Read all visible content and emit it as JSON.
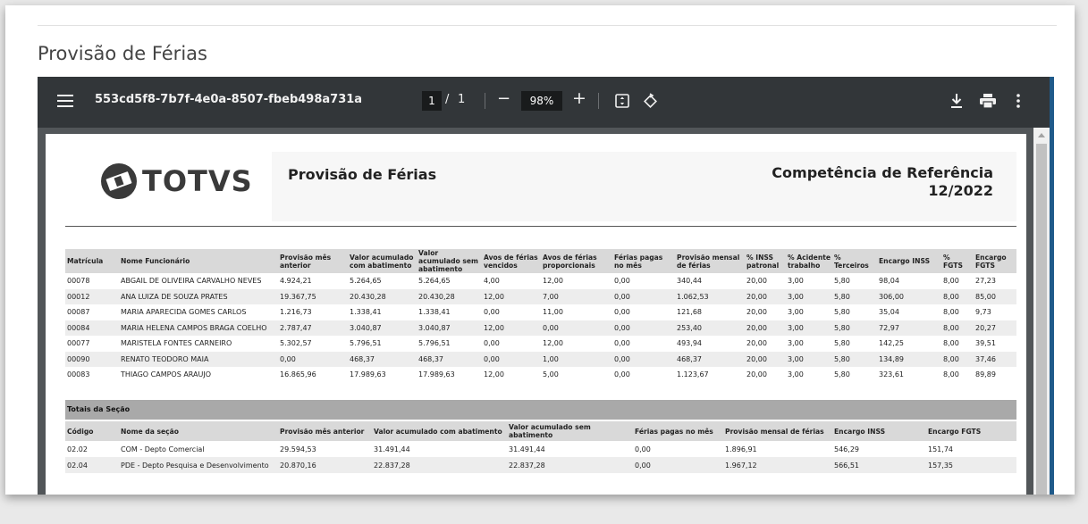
{
  "page": {
    "title": "Provisão de Férias"
  },
  "viewer": {
    "document_name": "553cd5f8-7b7f-4e0a-8507-fbeb498a731a",
    "current_page": "1",
    "page_separator": "/",
    "total_pages": "1",
    "zoom": "98%",
    "zoom_out": "−",
    "zoom_in": "+",
    "icons": [
      "menu-icon",
      "fit-page-icon",
      "rotate-icon",
      "download-icon",
      "print-icon",
      "more-options-icon"
    ]
  },
  "report": {
    "logo_text": "TOTVS",
    "title": "Provisão de Férias",
    "competence_label": "Competência de Referência",
    "competence_value": "12/2022",
    "employee_columns": [
      "Matrícula",
      "Nome Funcionário",
      "Provisão mês anterior",
      "Valor acumulado com abatimento",
      "Valor acumulado sem abatimento",
      "Avos de férias vencidos",
      "Avos de férias proporcionais",
      "Férias pagas no mês",
      "Provisão mensal de férias",
      "% INSS patronal",
      "% Acidente trabalho",
      "% Terceiros",
      "Encargo INSS",
      "% FGTS",
      "Encargo FGTS"
    ],
    "employees": [
      [
        "00078",
        "ABGAIL DE OLIVEIRA CARVALHO NEVES",
        "4.924,21",
        "5.264,65",
        "5.264,65",
        "4,00",
        "12,00",
        "0,00",
        "340,44",
        "20,00",
        "3,00",
        "5,80",
        "98,04",
        "8,00",
        "27,23"
      ],
      [
        "00012",
        "ANA LUIZA  DE SOUZA PRATES",
        "19.367,75",
        "20.430,28",
        "20.430,28",
        "12,00",
        "7,00",
        "0,00",
        "1.062,53",
        "20,00",
        "3,00",
        "5,80",
        "306,00",
        "8,00",
        "85,00"
      ],
      [
        "00087",
        "MARIA APARECIDA GOMES CARLOS",
        "1.216,73",
        "1.338,41",
        "1.338,41",
        "0,00",
        "11,00",
        "0,00",
        "121,68",
        "20,00",
        "3,00",
        "5,80",
        "35,04",
        "8,00",
        "9,73"
      ],
      [
        "00084",
        "MARIA HELENA CAMPOS BRAGA COELHO",
        "2.787,47",
        "3.040,87",
        "3.040,87",
        "12,00",
        "0,00",
        "0,00",
        "253,40",
        "20,00",
        "3,00",
        "5,80",
        "72,97",
        "8,00",
        "20,27"
      ],
      [
        "00077",
        "MARISTELA FONTES CARNEIRO",
        "5.302,57",
        "5.796,51",
        "5.796,51",
        "0,00",
        "12,00",
        "0,00",
        "493,94",
        "20,00",
        "3,00",
        "5,80",
        "142,25",
        "8,00",
        "39,51"
      ],
      [
        "00090",
        "RENATO TEODORO MAIA",
        "0,00",
        "468,37",
        "468,37",
        "0,00",
        "1,00",
        "0,00",
        "468,37",
        "20,00",
        "3,00",
        "5,80",
        "134,89",
        "8,00",
        "37,46"
      ],
      [
        "00083",
        "THIAGO CAMPOS ARAUJO",
        "16.865,96",
        "17.989,63",
        "17.989,63",
        "12,00",
        "5,00",
        "0,00",
        "1.123,67",
        "20,00",
        "3,00",
        "5,80",
        "323,61",
        "8,00",
        "89,89"
      ]
    ],
    "totals_label": "Totais da Seção",
    "section_columns": [
      "Código",
      "Nome da seção",
      "Provisão mês anterior",
      "Valor acumulado com abatimento",
      "Valor acumulado sem abatimento",
      "Férias pagas no mês",
      "Provisão mensal de férias",
      "Encargo INSS",
      "Encargo FGTS"
    ],
    "sections": [
      [
        "02.02",
        "COM - Depto Comercial",
        "29.594,53",
        "31.491,44",
        "31.491,44",
        "0,00",
        "1.896,91",
        "546,29",
        "151,74"
      ],
      [
        "02.04",
        "PDE - Depto Pesquisa e Desenvolvimento",
        "20.870,16",
        "22.837,28",
        "22.837,28",
        "0,00",
        "1.967,12",
        "566,51",
        "157,35"
      ]
    ]
  }
}
